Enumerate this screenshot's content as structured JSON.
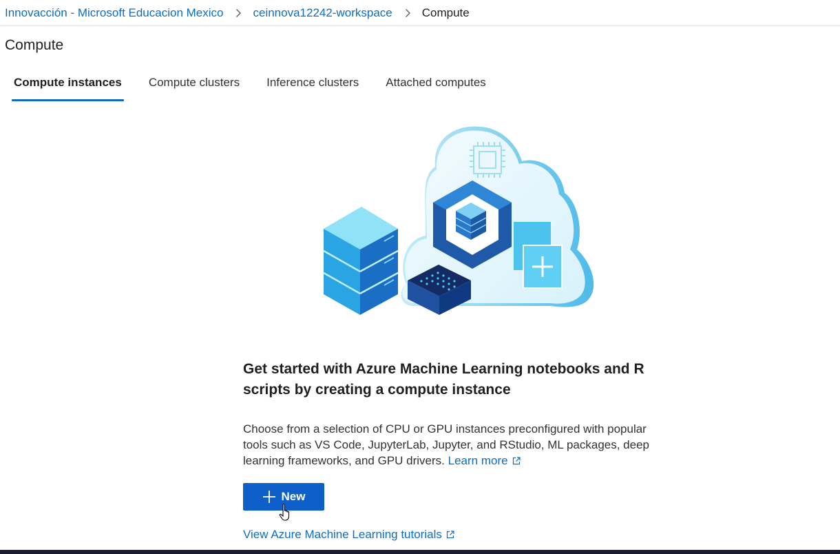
{
  "breadcrumb": {
    "items": [
      {
        "label": "Innovacción - Microsoft Educacion Mexico"
      },
      {
        "label": "ceinnova12242-workspace"
      }
    ],
    "current": "Compute",
    "separator_icon": "chevron-right-icon"
  },
  "page": {
    "title": "Compute"
  },
  "tabs": [
    {
      "label": "Compute instances",
      "active": true
    },
    {
      "label": "Compute clusters",
      "active": false
    },
    {
      "label": "Inference clusters",
      "active": false
    },
    {
      "label": "Attached computes",
      "active": false
    }
  ],
  "empty_state": {
    "illustration": "compute-cloud-illustration",
    "headline": "Get started with Azure Machine Learning notebooks and R scripts by creating a compute instance",
    "description": "Choose from a selection of CPU or GPU instances preconfigured with popular tools such as VS Code, JupyterLab, Jupyter, and RStudio, ML packages, deep learning frameworks, and GPU drivers.",
    "learn_more": "Learn more",
    "new_button": "New",
    "tutorials_link": "View Azure Machine Learning tutorials"
  },
  "colors": {
    "accent": "#0f6cbd",
    "primary_button": "#0f5fc8",
    "text": "#201f1e"
  }
}
